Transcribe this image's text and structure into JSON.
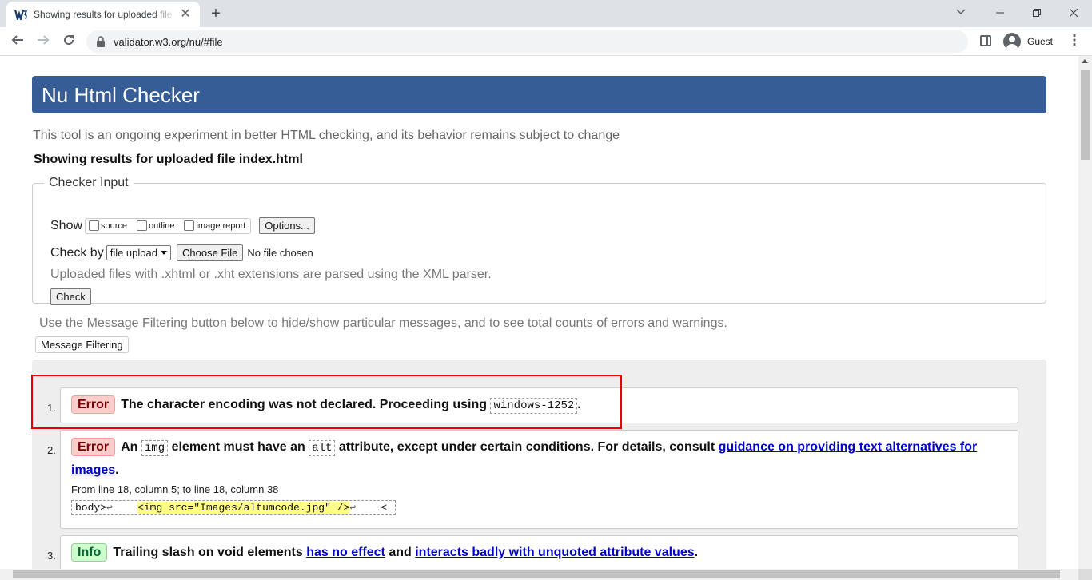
{
  "browser": {
    "tab_title": "Showing results for uploaded file index.html",
    "tab_close": "✕",
    "new_tab": "+",
    "url": "validator.w3.org/nu/#file",
    "profile_label": "Guest"
  },
  "page": {
    "banner_title": "Nu Html Checker",
    "tagline": "This tool is an ongoing experiment in better HTML checking, and its behavior remains subject to change",
    "results_title": "Showing results for uploaded file index.html",
    "checker": {
      "legend": "Checker Input",
      "show_label": "Show",
      "show_options": [
        "source",
        "outline",
        "image report"
      ],
      "options_button": "Options...",
      "checkby_label": "Check by",
      "checkby_selected": "file upload",
      "choose_file_button": "Choose File",
      "no_file_text": "No file chosen",
      "xml_note": "Uploaded files with .xhtml or .xht extensions are parsed using the XML parser.",
      "check_button": "Check"
    },
    "filter_note": "Use the Message Filtering button below to hide/show particular messages, and to see total counts of errors and warnings.",
    "filter_button": "Message Filtering"
  },
  "messages": [
    {
      "num": "1.",
      "type": "Error",
      "text_before": "The character encoding was not declared. Proceeding using",
      "code": "windows-1252",
      "text_after": "."
    },
    {
      "num": "2.",
      "type": "Error",
      "t1": "An",
      "code1": "img",
      "t2": "element must have an",
      "code2": "alt",
      "t3": "attribute, except under certain conditions. For details, consult",
      "link": "guidance on providing text alternatives for images",
      "t4": ".",
      "location": "From line 18, column 5; to line 18, column 38",
      "extract_before": "body>",
      "extract_ret1": "↩",
      "extract_gap": "    ",
      "extract_highlight": "<img src=\"Images/altumcode.jpg\" />",
      "extract_ret2": "↩",
      "extract_after": "    <"
    },
    {
      "num": "3.",
      "type": "Info",
      "t1": "Trailing slash on void elements",
      "link1": "has no effect",
      "t2": "and",
      "link2": "interacts badly with unquoted attribute values",
      "t3": "."
    }
  ],
  "colors": {
    "banner": "#365d95",
    "annotation_box": "#e00000",
    "error_badge_bg": "#ffcccc",
    "info_badge_bg": "#ccffcc",
    "link": "#0000cc"
  }
}
